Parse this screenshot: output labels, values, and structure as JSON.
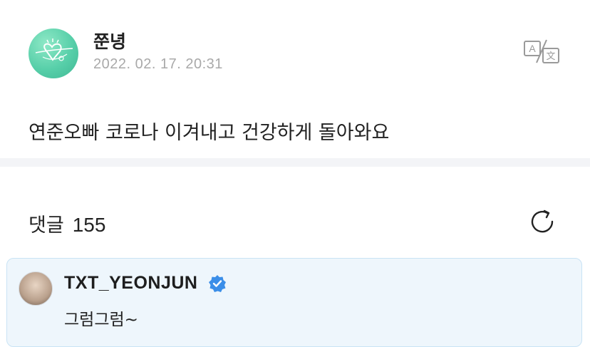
{
  "post": {
    "author": "쭌녕",
    "timestamp": "2022. 02. 17. 20:31",
    "text": "연준오빠 코로나 이겨내고 건강하게 돌아와요",
    "avatar_icon": "heart-doodle-icon",
    "translate_icon": "translate-icon"
  },
  "comments": {
    "label": "댓글",
    "count": "155",
    "refresh_icon": "refresh-icon",
    "items": [
      {
        "author": "TXT_YEONJUN",
        "verified": true,
        "text": "그럼그럼~"
      }
    ]
  },
  "colors": {
    "verified_badge": "#3b8ee8",
    "artist_comment_bg": "#eef6fc",
    "timestamp": "#a9a9a9",
    "divider": "#f3f4f7"
  }
}
